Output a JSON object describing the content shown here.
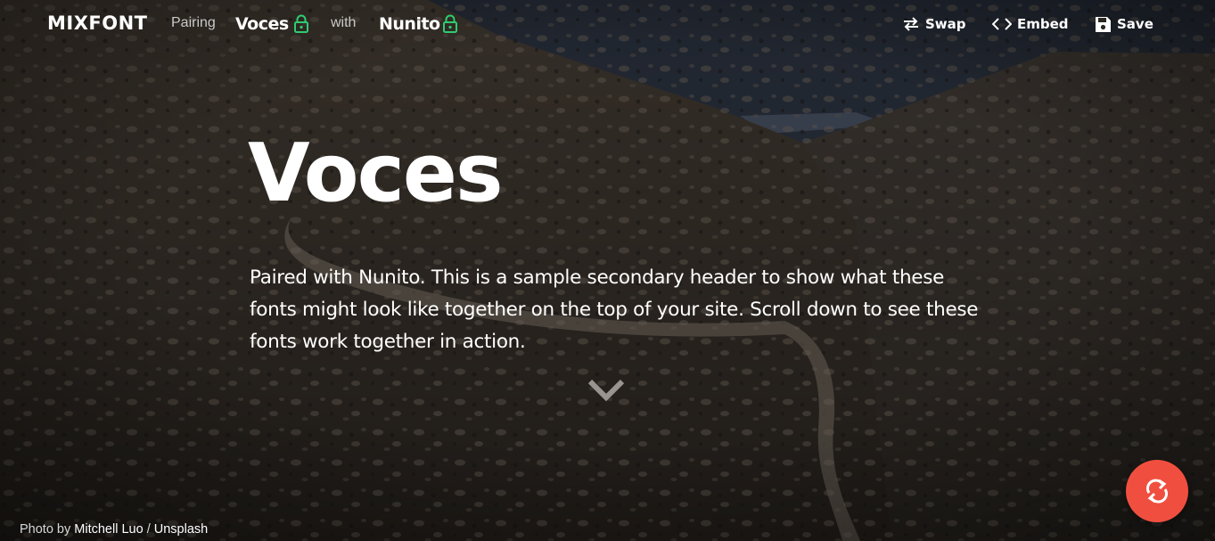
{
  "header": {
    "logo": "MIXFONT",
    "pairing_label": "Pairing",
    "primary_font": "Voces",
    "with_label": "with",
    "secondary_font": "Nunito",
    "actions": {
      "swap": "Swap",
      "embed": "Embed",
      "save": "Save"
    },
    "lock_color": "#2ecc71"
  },
  "hero": {
    "title": "Voces",
    "subtitle": "Paired with Nunito. This is a sample secondary header to show what these fonts might look like together on the top of your site. Scroll down to see these fonts work together in action.",
    "scroll_icon": "chevron-down-icon"
  },
  "credit": {
    "prefix": "Photo by",
    "author": "Mitchell Luo",
    "separator": "/",
    "source": "Unsplash"
  },
  "fab": {
    "icon": "refresh-icon",
    "color": "#f04f3f"
  }
}
